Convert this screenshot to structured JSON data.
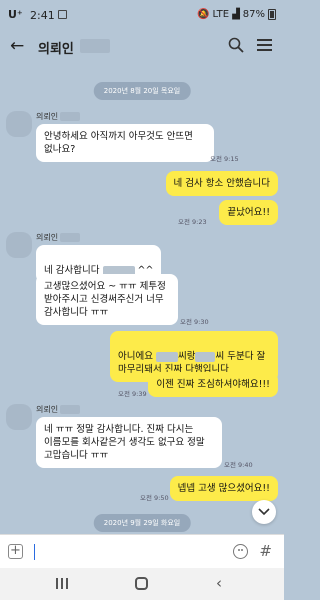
{
  "status": {
    "carrier": "U⁺",
    "time": "2:41",
    "network": "LTE",
    "battery": "87%"
  },
  "header": {
    "title": "의뢰인"
  },
  "messages": {
    "date1": "2020년 8월 20일 목요일",
    "sender_name": "의뢰인",
    "m1": "안녕하세요 아직까지 아무것도 안뜨면\n없나요?",
    "t1": "오전 9:15",
    "m2": "네 검사 항소 안했습니다",
    "m3": "끝났어요!!",
    "t2": "오전 9:23",
    "m4_prefix": "네 감사합니다",
    "m4_suffix": "^^",
    "m5": "고생많으셨어요 ~ ㅠㅠ 제투정\n받아주시고 신경써주신거 너무\n감사합니다 ㅠㅠ",
    "t3": "오전 9:30",
    "m6_a": "아니에요",
    "m6_b": "씨랑",
    "m6_c": "씨 두분다 잘",
    "m6_line2": "마무리돼서 진짜 다행입니다",
    "m7": "이젠 진짜 조심하셔야해요!!!",
    "t4": "오전 9:39",
    "m8": "네 ㅠㅠ 정말 감사합니다. 진짜 다시는\n이름모를 회사같은거 생각도 없구요 정말\n고맙습니다 ㅠㅠ",
    "t5": "오전 9:40",
    "m9": "넵넵 고생 많으셨어요!!",
    "t6": "오전 9:50",
    "date2": "2020년 9월 29일 화요일"
  },
  "input": {
    "placeholder": ""
  }
}
